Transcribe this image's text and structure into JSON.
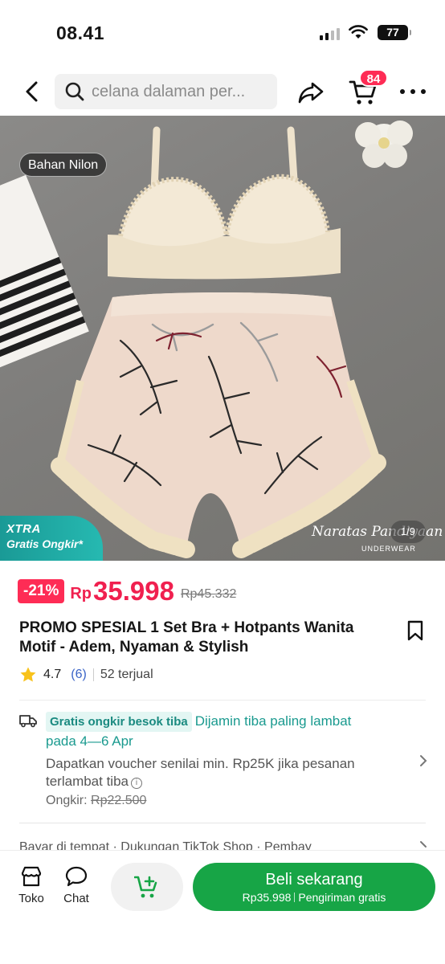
{
  "status_bar": {
    "time": "08.41",
    "battery": "77"
  },
  "nav": {
    "search_placeholder": "celana dalaman per...",
    "cart_count": "84"
  },
  "product_image": {
    "material_tag": "Bahan Nilon",
    "xtra_title": "XTRA",
    "xtra_subtitle": "Gratis Ongkir*",
    "brand": "Naratas Pandiyaan",
    "brand_sub": "UNDERWEAR",
    "page_counter": "1/9"
  },
  "price": {
    "discount": "-21%",
    "currency": "Rp",
    "current": "35.998",
    "original": "Rp45.332"
  },
  "product": {
    "title": "PROMO SPESIAL 1 Set Bra + Hotpants Wanita Motif - Adem, Nyaman & Stylish",
    "rating": "4.7",
    "reviews": "(6)",
    "sold": "52 terjual"
  },
  "shipping": {
    "badge": "Gratis ongkir besok tiba",
    "guarantee": "Dijamin tiba paling lambat pada 4—6 Apr",
    "voucher": "Dapatkan voucher senilai min. Rp25K jika pesanan terlambat tiba",
    "ongkir_label": "Ongkir:",
    "ongkir_old": "Rp22.500"
  },
  "services": {
    "text": "Bayar di tempat · Dukungan TikTok Shop · Pembay"
  },
  "bottom_bar": {
    "shop_label": "Toko",
    "chat_label": "Chat",
    "buy_title": "Beli sekarang",
    "buy_price": "Rp35.998",
    "buy_shipping": "Pengiriman gratis"
  },
  "colors": {
    "accent": "#fe2c55",
    "buy_green": "#17a546",
    "teal": "#1a9a8f"
  }
}
